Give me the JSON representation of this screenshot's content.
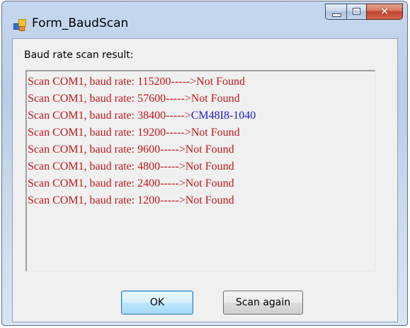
{
  "window": {
    "title": "Form_BaudScan",
    "close_glyph": "✕"
  },
  "content": {
    "label": "Baud rate scan result:",
    "results": [
      {
        "prefix": "Scan COM1, baud rate: 115200----->",
        "status": "Not Found",
        "found": false
      },
      {
        "prefix": "Scan COM1, baud rate: 57600----->",
        "status": "Not Found",
        "found": false
      },
      {
        "prefix": "Scan COM1, baud rate: 38400----->",
        "status": "CM48I8-1040",
        "found": true
      },
      {
        "prefix": "Scan COM1, baud rate: 19200----->",
        "status": "Not Found",
        "found": false
      },
      {
        "prefix": "Scan COM1, baud rate: 9600----->",
        "status": "Not Found",
        "found": false
      },
      {
        "prefix": "Scan COM1, baud rate: 4800----->",
        "status": "Not Found",
        "found": false
      },
      {
        "prefix": "Scan COM1, baud rate: 2400----->",
        "status": "Not Found",
        "found": false
      },
      {
        "prefix": "Scan COM1, baud rate: 1200----->",
        "status": "Not Found",
        "found": false
      }
    ]
  },
  "buttons": {
    "ok_label": "OK",
    "scan_again_label": "Scan again"
  },
  "colors": {
    "not_found": "#c0181c",
    "found": "#1c1ac8"
  },
  "icons": {
    "app": "app-form-icon",
    "minimize": "minimize-icon",
    "maximize": "maximize-icon",
    "close": "close-icon"
  }
}
